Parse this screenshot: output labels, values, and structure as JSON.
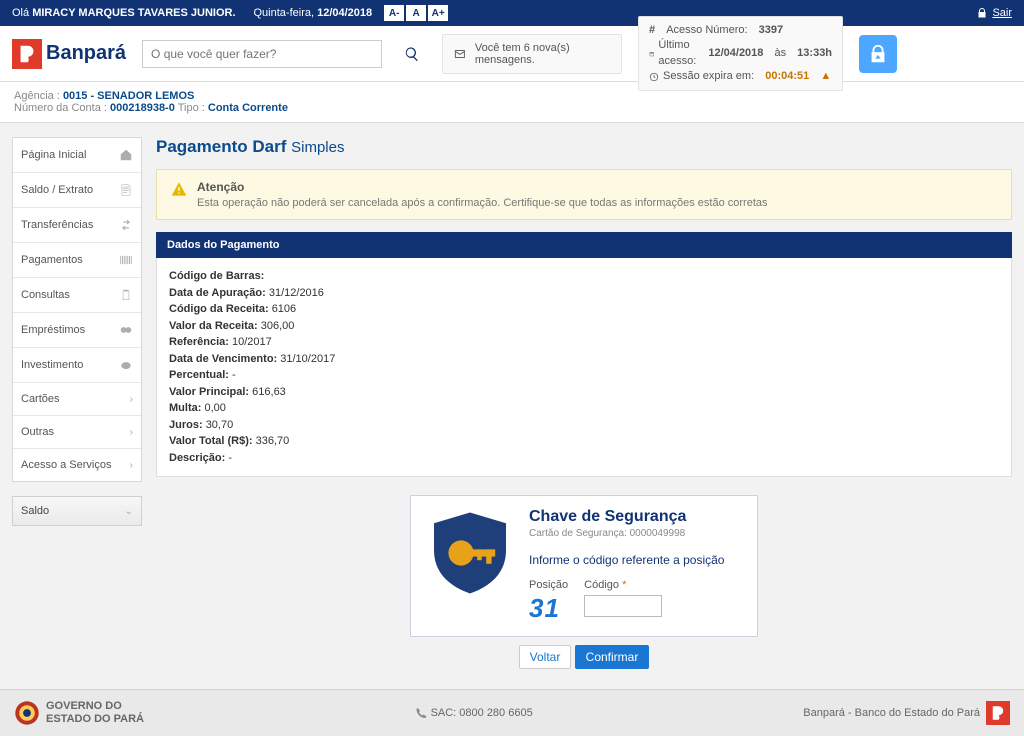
{
  "topbar": {
    "greeting": "Olá",
    "user": "MIRACY MARQUES TAVARES JUNIOR.",
    "day_label": "Quinta-feira,",
    "date": "12/04/2018",
    "zoom": {
      "minus": "A-",
      "normal": "A",
      "plus": "A+"
    },
    "logout": "Sair"
  },
  "header": {
    "brand": "Banpará",
    "search_placeholder": "O que você quer fazer?",
    "messages": "Você tem 6 nova(s) mensagens.",
    "access_number_label": "Acesso Número:",
    "access_number": "3397",
    "last_access_label": "Último acesso:",
    "last_access_date": "12/04/2018",
    "last_access_at": "às",
    "last_access_time": "13:33h",
    "session_label": "Sessão expira em:",
    "session_time": "00:04:51"
  },
  "account": {
    "agency_label": "Agência :",
    "agency": "0015 - SENADOR LEMOS",
    "account_label": "Número da Conta :",
    "account": "000218938-0",
    "type_label": "Tipo :",
    "type": "Conta Corrente"
  },
  "menu": {
    "items": [
      "Página Inicial",
      "Saldo / Extrato",
      "Transferências",
      "Pagamentos",
      "Consultas",
      "Empréstimos",
      "Investimento",
      "Cartões",
      "Outras",
      "Acesso a Serviços"
    ],
    "saldo": "Saldo"
  },
  "page": {
    "title_main": "Pagamento Darf",
    "title_sub": "Simples"
  },
  "alert": {
    "title": "Atenção",
    "msg": "Esta operação não poderá ser cancelada após a confirmação. Certifique-se que todas as informações estão corretas"
  },
  "panel": {
    "title": "Dados do Pagamento",
    "rows": [
      {
        "k": "Código de Barras:",
        "v": ""
      },
      {
        "k": "Data de Apuração:",
        "v": "31/12/2016"
      },
      {
        "k": "Código da Receita:",
        "v": "6106"
      },
      {
        "k": "Valor da Receita:",
        "v": "306,00"
      },
      {
        "k": "Referência:",
        "v": "10/2017"
      },
      {
        "k": "Data de Vencimento:",
        "v": "31/10/2017"
      },
      {
        "k": "Percentual:",
        "v": "-"
      },
      {
        "k": "Valor Principal:",
        "v": "616,63"
      },
      {
        "k": "Multa:",
        "v": "0,00"
      },
      {
        "k": "Juros:",
        "v": "30,70"
      },
      {
        "k": "Valor Total (R$):",
        "v": "336,70"
      },
      {
        "k": "Descrição:",
        "v": "-"
      }
    ]
  },
  "security": {
    "title": "Chave de Segurança",
    "card_label": "Cartão de Segurança: 0000049998",
    "prompt": "Informe o código referente a posição",
    "pos_label": "Posição",
    "pos_value": "31",
    "code_label": "Código",
    "btn_back": "Voltar",
    "btn_confirm": "Confirmar"
  },
  "footer": {
    "gov1": "GOVERNO DO",
    "gov2": "ESTADO DO PARÁ",
    "sac": "SAC: 0800 280 6605",
    "text": "Banpará - Banco do Estado do Pará"
  }
}
